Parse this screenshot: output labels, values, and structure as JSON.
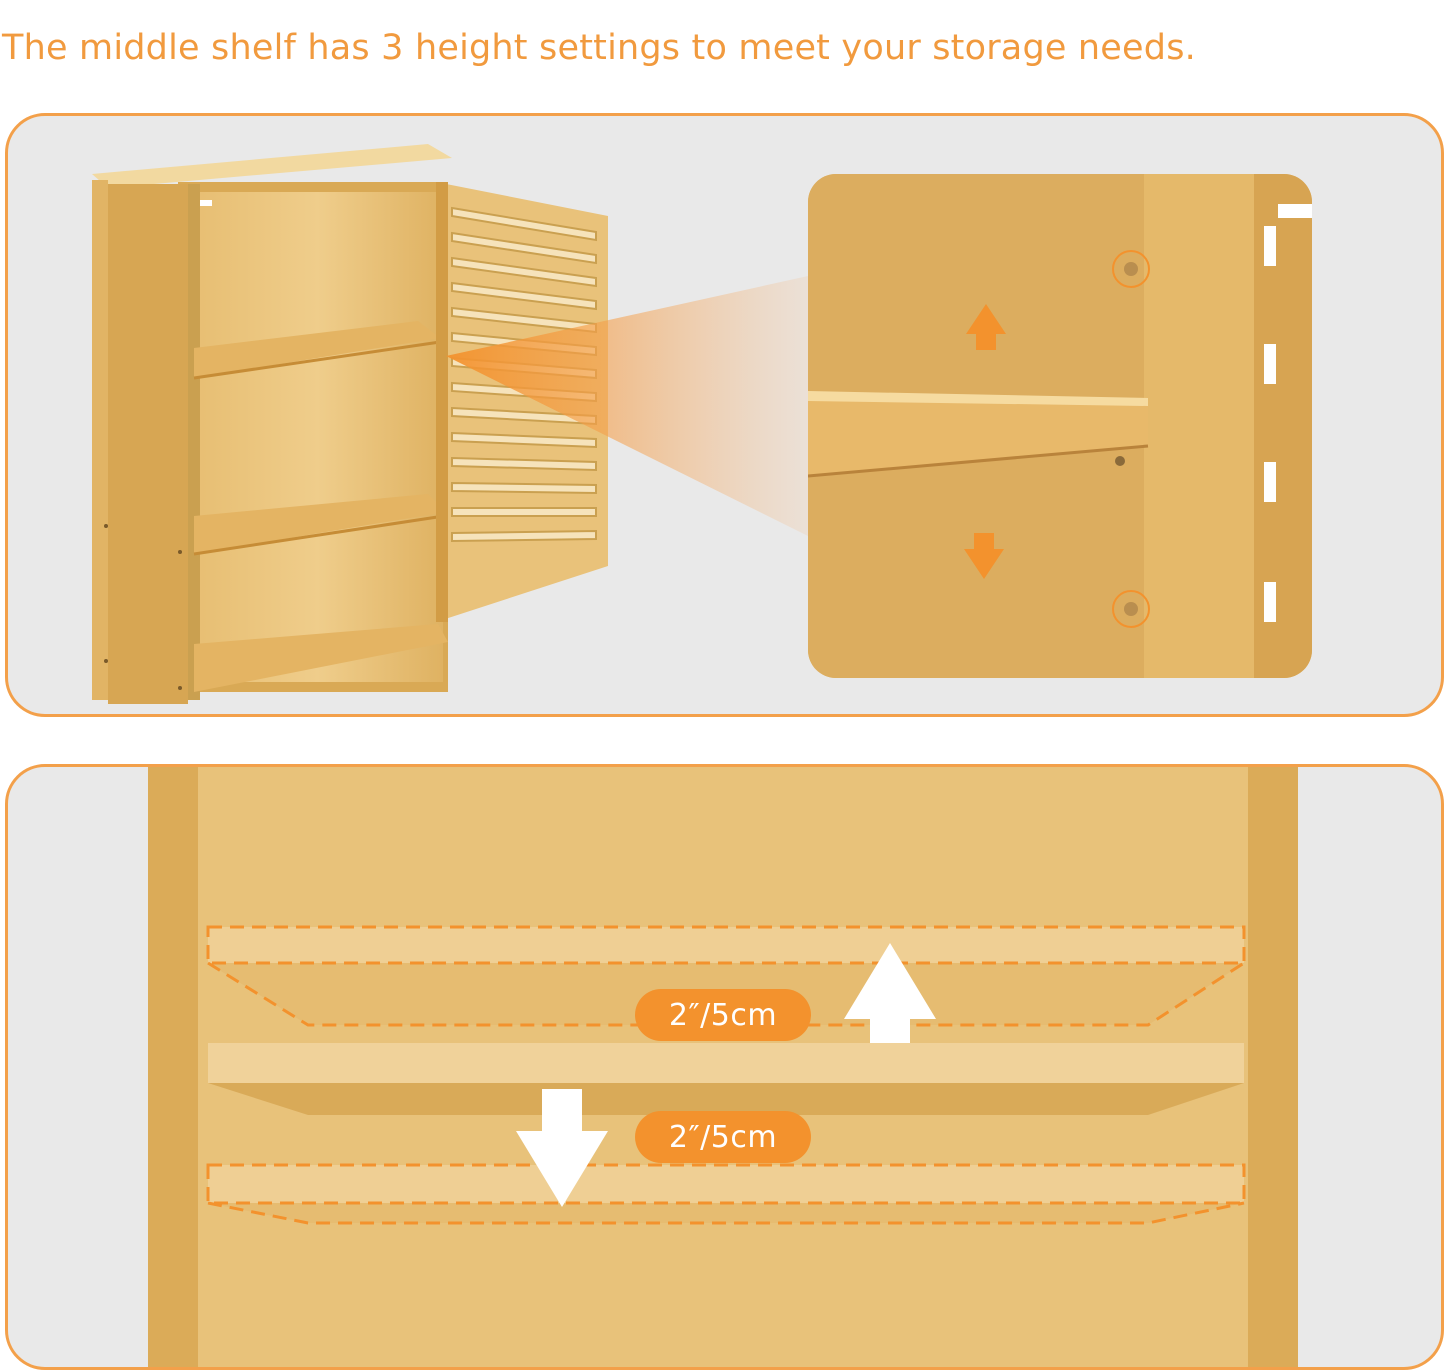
{
  "headline": "The middle shelf has 3 height settings to meet your storage needs.",
  "measurements": {
    "upper_gap": "2″/5cm",
    "lower_gap": "2″/5cm"
  },
  "colors": {
    "accent": "#f3922d",
    "panel_border": "#f3a04a",
    "panel_bg": "#e9e9e9",
    "wood_light": "#e9c27a",
    "wood_mid": "#dcae5c",
    "wood_dark": "#c9933f"
  },
  "icons": {
    "up_arrow": "up-arrow-icon",
    "down_arrow": "down-arrow-icon"
  }
}
